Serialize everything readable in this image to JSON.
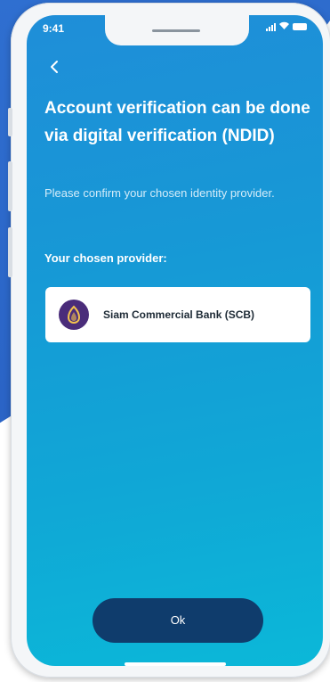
{
  "status_bar": {
    "time": "9:41"
  },
  "header": {
    "back_icon": "chevron-left-icon",
    "title": "Account verification can be done via digital verification (NDID)",
    "subtitle": "Please confirm your chosen identity provider."
  },
  "provider_section": {
    "label": "Your chosen provider:",
    "provider": {
      "name": "Siam Commercial Bank (SCB)",
      "logo_icon": "scb-logo-icon",
      "logo_color": "#4a2c7a"
    }
  },
  "footer": {
    "ok_label": "Ok"
  },
  "colors": {
    "screen_gradient_top": "#1f8ed8",
    "screen_gradient_bottom": "#0bb8d8",
    "button_bg": "#0f3c6c",
    "backdrop_blue": "#2f6fd0"
  }
}
